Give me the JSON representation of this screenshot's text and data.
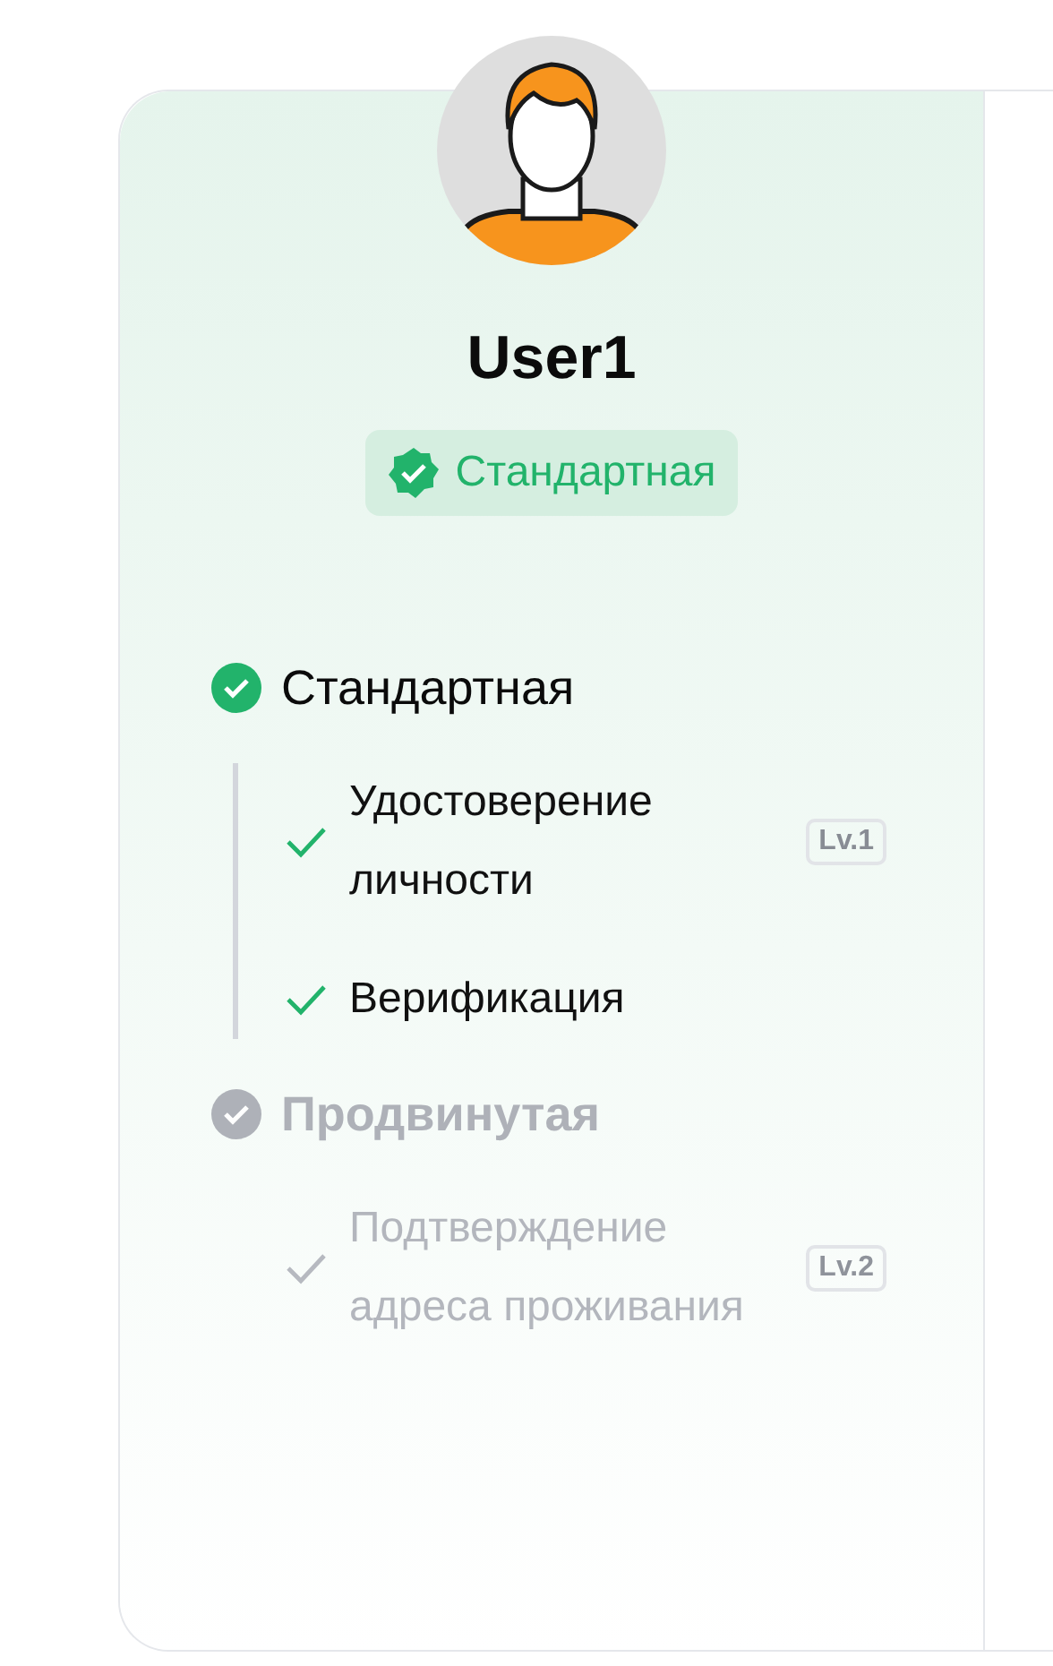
{
  "profile": {
    "name": "User1",
    "badge": "Стандартная"
  },
  "levels": [
    {
      "title": "Стандартная",
      "completed": true,
      "items": [
        {
          "label": "Удостоверение личности",
          "completed": true,
          "tag": "Lv.1"
        },
        {
          "label": "Верификация",
          "completed": true
        }
      ]
    },
    {
      "title": "Продвинутая",
      "completed": false,
      "items": [
        {
          "label": "Подтверждение адреса проживания",
          "completed": false,
          "tag": "Lv.2"
        }
      ]
    }
  ]
}
